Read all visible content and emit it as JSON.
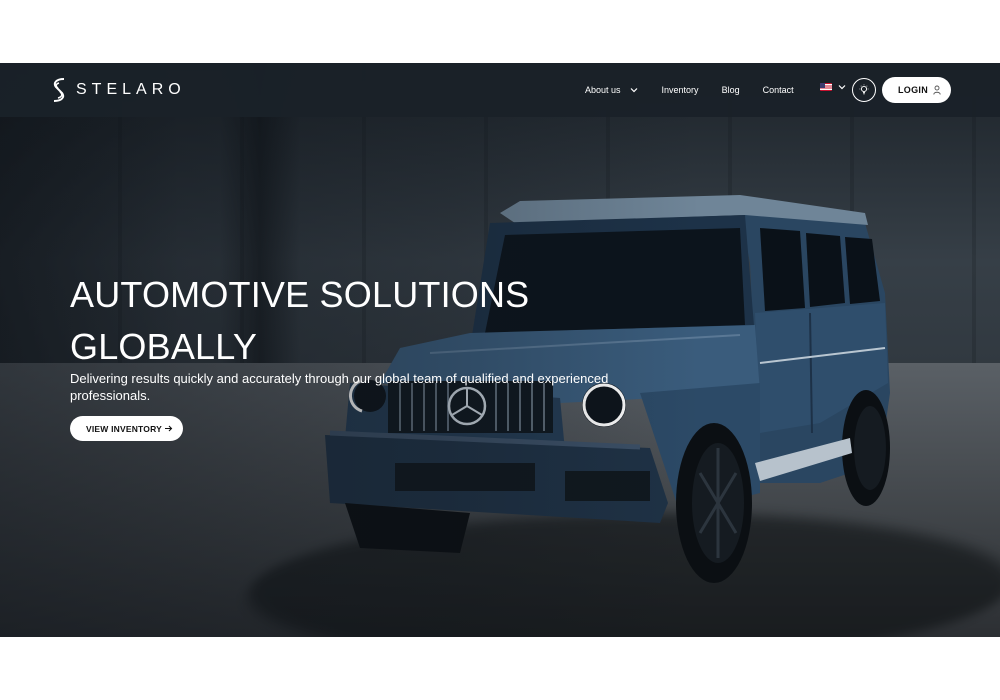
{
  "brand": {
    "name": "STELARO",
    "logo_icon": "stelaro-s-logo-icon"
  },
  "nav": {
    "items": [
      {
        "label": "About us",
        "has_dropdown": true
      },
      {
        "label": "Inventory",
        "has_dropdown": false
      },
      {
        "label": "Blog",
        "has_dropdown": false
      },
      {
        "label": "Contact",
        "has_dropdown": false
      }
    ],
    "language_icon": "us-flag-icon",
    "theme_icon": "lightbulb-icon",
    "login_label": "LOGIN",
    "login_icon": "user-icon"
  },
  "hero": {
    "title_line1": "AUTOMOTIVE SOLUTIONS",
    "title_line2": "GLOBALLY",
    "subtitle": "Delivering results quickly and accurately through our global team of qualified and experienced professionals.",
    "cta_label": "VIEW INVENTORY",
    "cta_icon": "arrow-right-icon"
  },
  "colors": {
    "navbar_bg": "#1a2129",
    "car_body": "#2d4a66",
    "button_bg": "#ffffff",
    "text_light": "#ffffff"
  }
}
